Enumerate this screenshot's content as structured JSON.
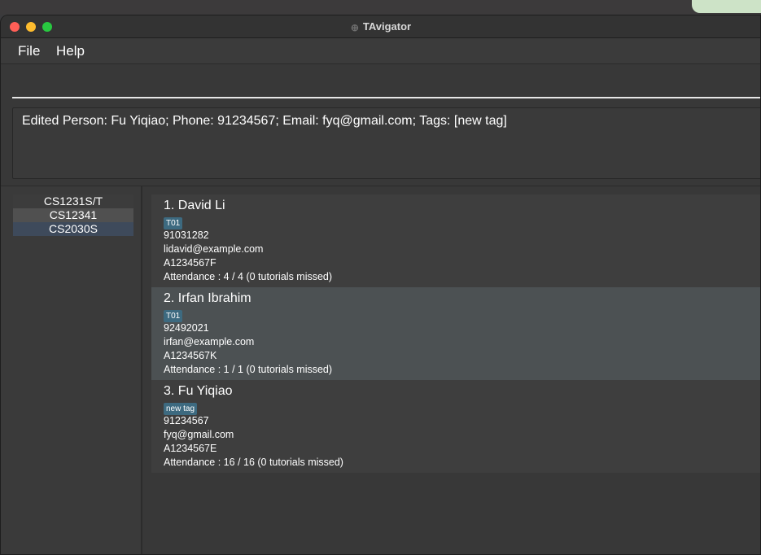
{
  "window": {
    "title": "TAvigator"
  },
  "menu": {
    "file": "File",
    "help": "Help"
  },
  "command": {
    "value": ""
  },
  "result": {
    "text": "Edited Person: Fu Yiqiao; Phone: 91234567; Email: fyq@gmail.com; Tags: [new tag]"
  },
  "classes": [
    {
      "label": "CS1231S/T"
    },
    {
      "label": "CS12341"
    },
    {
      "label": "CS2030S"
    }
  ],
  "persons": [
    {
      "index_name": "1.  David Li",
      "tag": "T01",
      "phone": "91031282",
      "email": "lidavid@example.com",
      "student_id": "A1234567F",
      "attendance": "Attendance : 4 / 4 (0 tutorials missed)"
    },
    {
      "index_name": "2.  Irfan Ibrahim",
      "tag": "T01",
      "phone": "92492021",
      "email": "irfan@example.com",
      "student_id": "A1234567K",
      "attendance": "Attendance : 1 / 1 (0 tutorials missed)"
    },
    {
      "index_name": "3.  Fu Yiqiao",
      "tag": "new tag",
      "phone": "91234567",
      "email": "fyq@gmail.com",
      "student_id": "A1234567E",
      "attendance": "Attendance : 16 / 16 (0 tutorials missed)"
    }
  ],
  "colors": {
    "tag_bg": "#3d6a80",
    "selected_class_bg": "#3e4a5b",
    "command_underline": "#e6e6e6"
  }
}
